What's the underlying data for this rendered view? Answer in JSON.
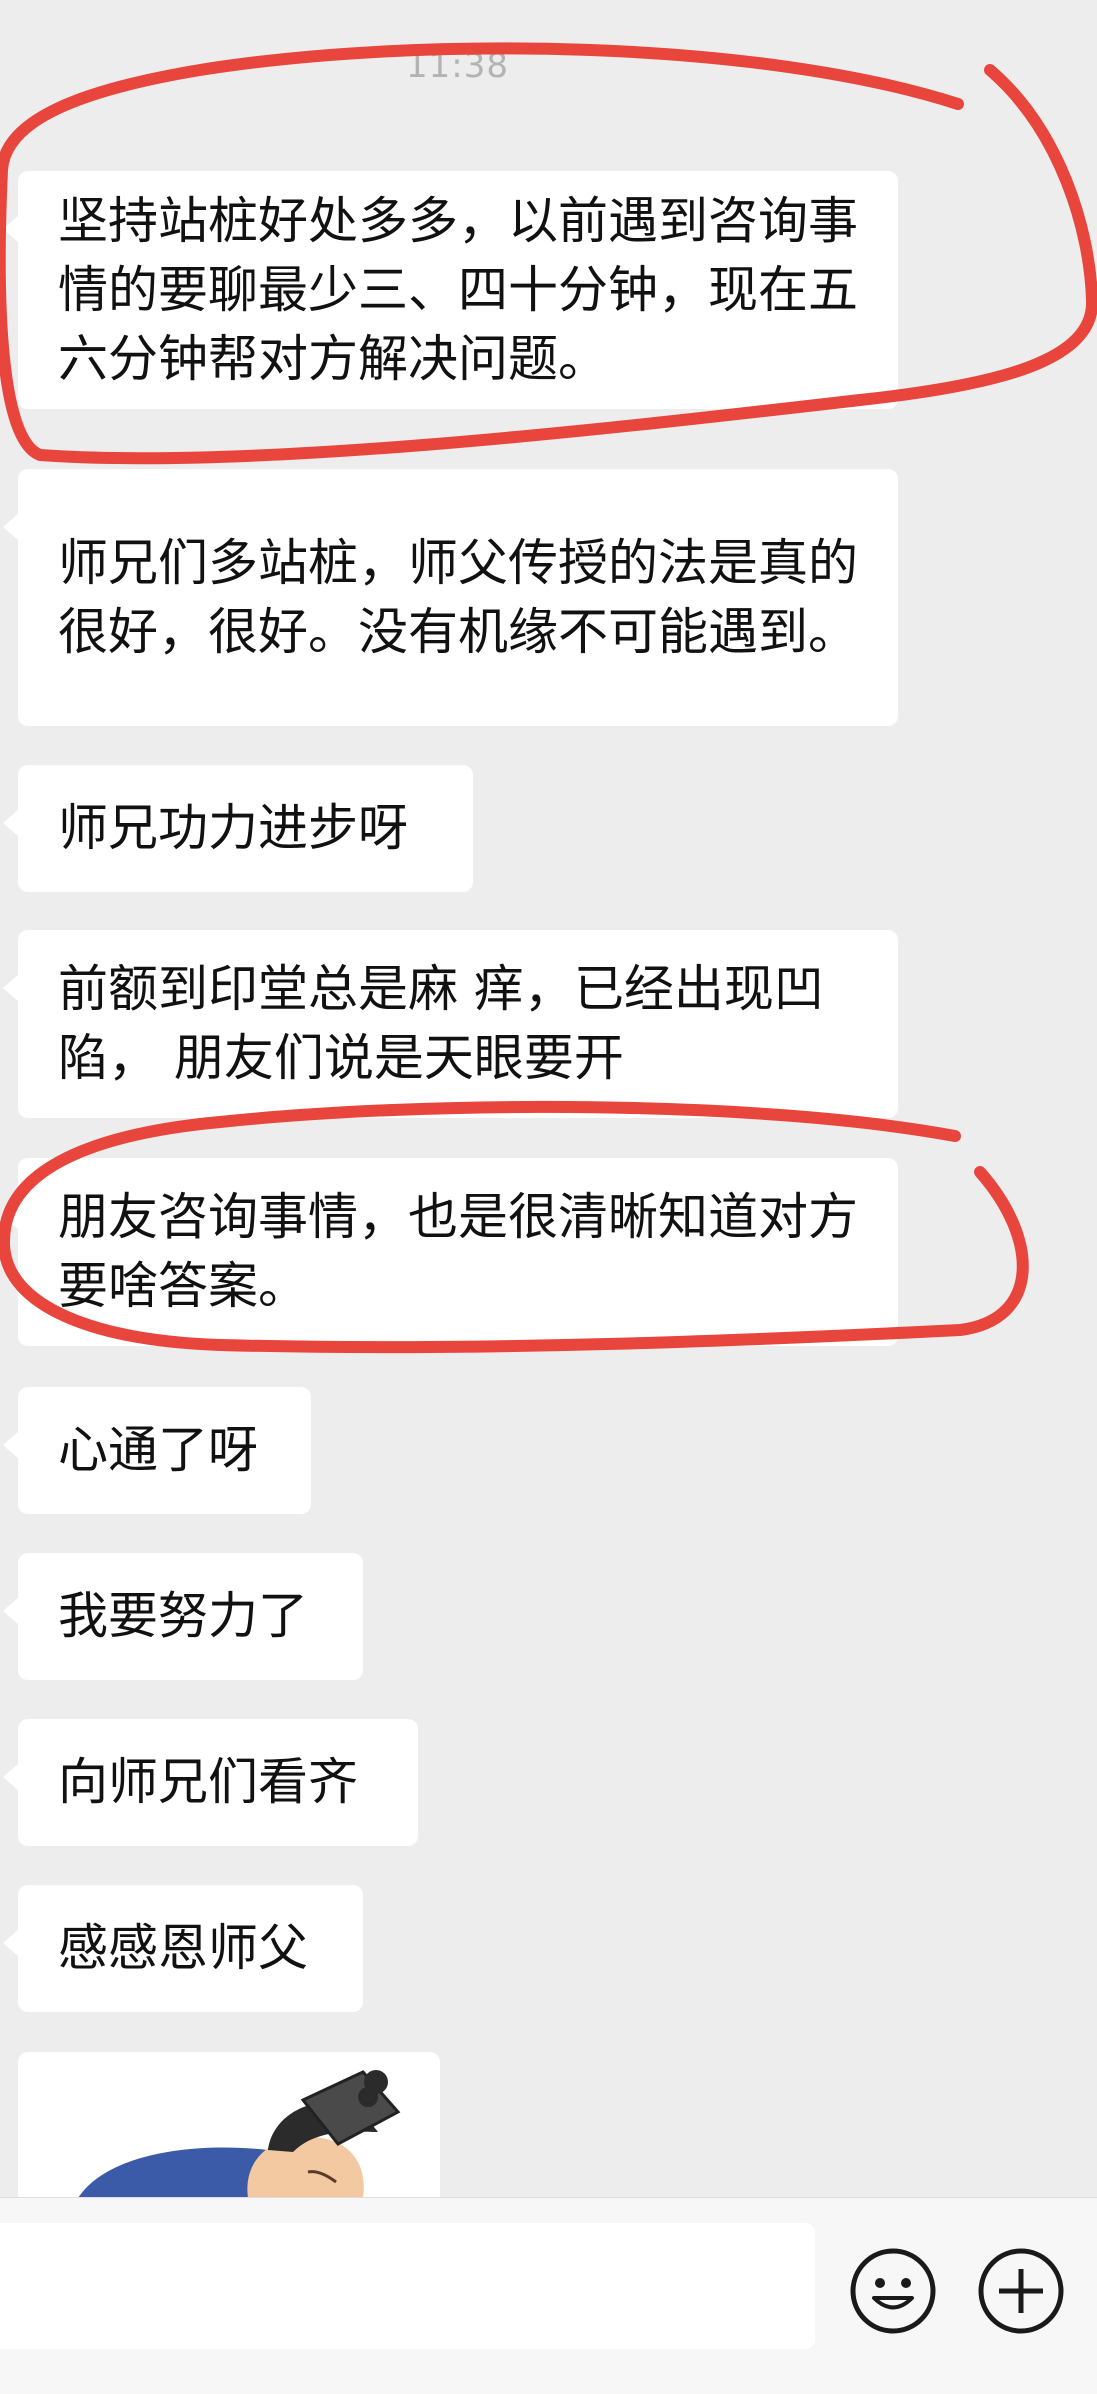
{
  "chat": {
    "time_separator": "11:38",
    "messages": [
      {
        "text": "坚持站桩好处多多，以前遇到咨询事情的要聊最少三、四十分钟，现在五六分钟帮对方解决问题。"
      },
      {
        "text": "师兄们多站桩，师父传授的法是真的很好，很好。没有机缘不可能遇到。"
      },
      {
        "text": "师兄功力进步呀"
      },
      {
        "text": "前额到印堂总是麻 痒，已经出现凹陷， 朋友们说是天眼要开"
      },
      {
        "text": "朋友咨询事情，也是很清晰知道对方要啥答案。"
      },
      {
        "text": "心通了呀"
      },
      {
        "text": "我要努力了"
      },
      {
        "text": "向师兄们看齐"
      },
      {
        "text": "感感恩师父"
      }
    ]
  },
  "input_bar": {
    "message_value": "",
    "emoji_icon": "smiley-face-icon",
    "plus_icon": "plus-circle-icon"
  },
  "colors": {
    "background": "#ededed",
    "bubble": "#ffffff",
    "annotation": "#e8453c"
  }
}
